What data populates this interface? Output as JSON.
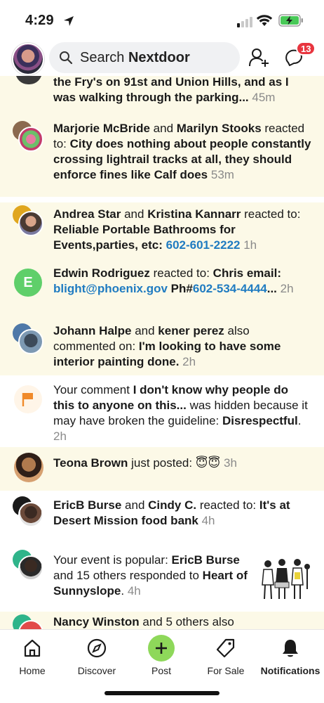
{
  "status_bar": {
    "time": "4:29"
  },
  "header": {
    "search_placeholder_prefix": "Search",
    "search_placeholder_brand": "Nextdoor",
    "chat_badge_count": "13"
  },
  "feed": [
    {
      "parts": [
        {
          "t": "b",
          "v": "the Fry's on 91st and Union Hills, and as I was walking through the parking..."
        },
        {
          "t": "time",
          "v": " 45m"
        }
      ]
    },
    {
      "parts": [
        {
          "t": "b",
          "v": "Marjorie McBride"
        },
        {
          "t": "n",
          "v": " and "
        },
        {
          "t": "b",
          "v": "Marilyn Stooks"
        },
        {
          "t": "n",
          "v": " reacted to: "
        },
        {
          "t": "b",
          "v": "City does nothing about people constantly crossing lightrail tracks at all, they should enforce fines like Calf does"
        },
        {
          "t": "time",
          "v": " 53m"
        }
      ]
    },
    {
      "parts": [
        {
          "t": "b",
          "v": "Andrea Star"
        },
        {
          "t": "n",
          "v": " and "
        },
        {
          "t": "b",
          "v": "Kristina Kannarr"
        },
        {
          "t": "n",
          "v": " reacted to: "
        },
        {
          "t": "b",
          "v": "Reliable Portable Bathrooms for Events,parties, etc: "
        },
        {
          "t": "link",
          "v": "602-601-2222"
        },
        {
          "t": "time",
          "v": " 1h"
        }
      ]
    },
    {
      "avatar_letter": "E",
      "parts": [
        {
          "t": "b",
          "v": "Edwin Rodriguez"
        },
        {
          "t": "n",
          "v": " reacted to: "
        },
        {
          "t": "b",
          "v": "Chris email: "
        },
        {
          "t": "link",
          "v": "blight@phoenix.gov"
        },
        {
          "t": "b",
          "v": " Ph#"
        },
        {
          "t": "link",
          "v": "602-534-4444"
        },
        {
          "t": "b",
          "v": "..."
        },
        {
          "t": "time",
          "v": " 2h"
        }
      ]
    },
    {
      "parts": [
        {
          "t": "b",
          "v": "Johann Halpe"
        },
        {
          "t": "n",
          "v": " and "
        },
        {
          "t": "b",
          "v": "kener perez"
        },
        {
          "t": "n",
          "v": " also commented on: "
        },
        {
          "t": "b",
          "v": "I'm looking to have some interior painting done."
        },
        {
          "t": "time",
          "v": " 2h"
        }
      ]
    },
    {
      "parts": [
        {
          "t": "n",
          "v": "Your comment "
        },
        {
          "t": "b",
          "v": "I don't know why people do this to anyone on this..."
        },
        {
          "t": "n",
          "v": " was hidden because it may have broken the guideline: "
        },
        {
          "t": "b",
          "v": "Disrespectful"
        },
        {
          "t": "n",
          "v": "."
        },
        {
          "t": "time",
          "v": " 2h"
        }
      ]
    },
    {
      "parts": [
        {
          "t": "b",
          "v": "Teona Brown"
        },
        {
          "t": "n",
          "v": " just posted: 😇😇"
        },
        {
          "t": "time",
          "v": " 3h"
        }
      ]
    },
    {
      "parts": [
        {
          "t": "b",
          "v": "EricB Burse"
        },
        {
          "t": "n",
          "v": " and "
        },
        {
          "t": "b",
          "v": "Cindy C."
        },
        {
          "t": "n",
          "v": " reacted to: "
        },
        {
          "t": "b",
          "v": "It's at Desert Mission food bank"
        },
        {
          "t": "time",
          "v": " 4h"
        }
      ]
    },
    {
      "parts": [
        {
          "t": "n",
          "v": "Your event is popular: "
        },
        {
          "t": "b",
          "v": "EricB Burse"
        },
        {
          "t": "n",
          "v": " and 15 others responded to "
        },
        {
          "t": "b",
          "v": "Heart of Sunnyslope"
        },
        {
          "t": "n",
          "v": "."
        },
        {
          "t": "time",
          "v": " 4h"
        }
      ]
    },
    {
      "parts": [
        {
          "t": "b",
          "v": "Nancy Winston"
        },
        {
          "t": "n",
          "v": " and 5 others also"
        }
      ]
    }
  ],
  "tabs": [
    {
      "label": "Home",
      "icon": "home-icon"
    },
    {
      "label": "Discover",
      "icon": "compass-icon"
    },
    {
      "label": "Post",
      "icon": "plus-icon"
    },
    {
      "label": "For Sale",
      "icon": "price-tag-icon"
    },
    {
      "label": "Notifications",
      "icon": "bell-icon"
    }
  ],
  "colors": {
    "unread_bg": "#fcf9e7",
    "link": "#1f7bc1",
    "badge": "#e8353f",
    "post_button": "#8ed85a",
    "edwin_avatar": "#5fcf6a"
  }
}
